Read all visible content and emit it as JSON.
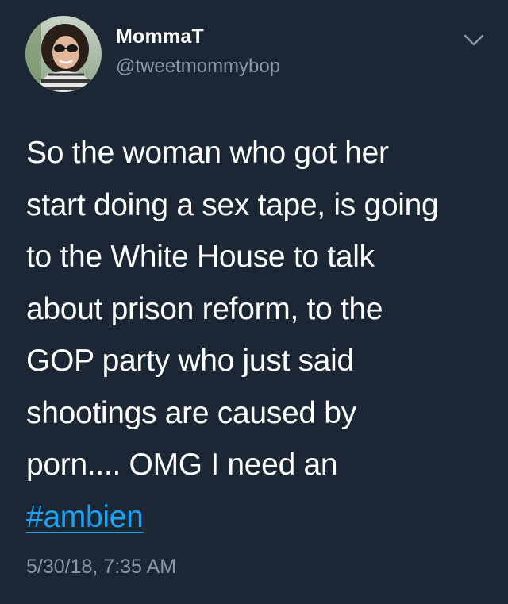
{
  "author": {
    "display_name": "MommaT",
    "handle": "@tweetmommybop",
    "avatar_icon": "user-avatar-photo"
  },
  "menu": {
    "icon": "chevron-down-icon"
  },
  "tweet": {
    "lines": [
      "So the woman who got her",
      "start doing a sex tape, is going",
      "to the White House to talk",
      "about prison reform, to the",
      "GOP party who just said",
      "shootings are caused by",
      "porn.... OMG I need an"
    ],
    "hashtag": "#ambien",
    "timestamp": "5/30/18, 7:35 AM"
  },
  "colors": {
    "background": "#1b2734",
    "text": "#ffffff",
    "secondary_text": "#8899a6",
    "link": "#1da1f2"
  }
}
